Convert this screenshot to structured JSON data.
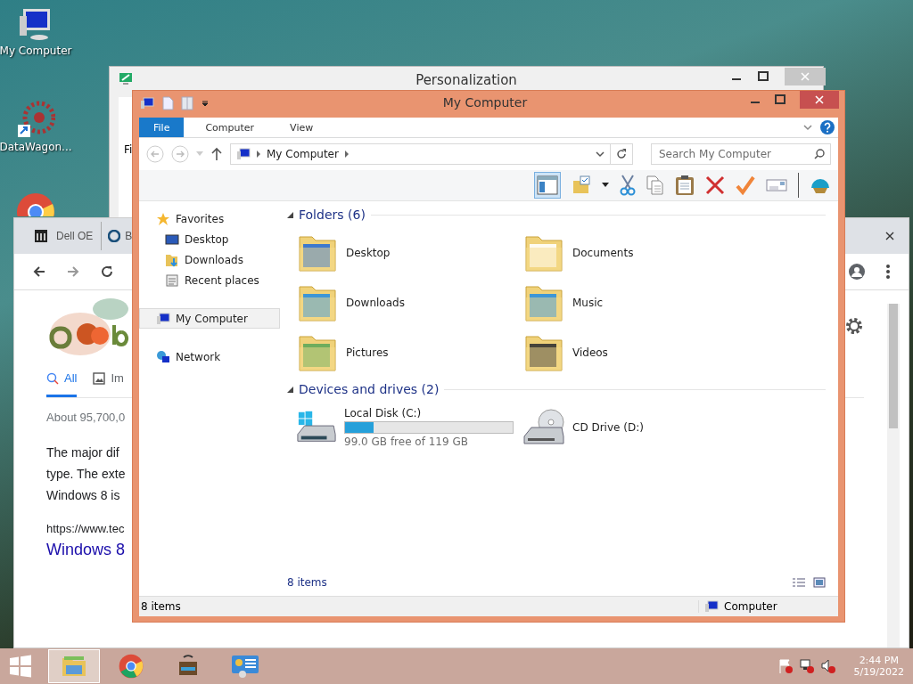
{
  "desktop_icons": [
    {
      "label": "My Computer",
      "kind": "computer"
    },
    {
      "label": "DataWagon...",
      "kind": "shortcut"
    },
    {
      "kind": "chrome"
    }
  ],
  "personalization_window": {
    "title": "Personalization",
    "menu_text": "Fi"
  },
  "browser_window": {
    "tabs": [
      "Dell OE",
      "B"
    ],
    "search_tabs": [
      {
        "label": "All",
        "selected": true,
        "kind": "search"
      },
      {
        "label": "Im",
        "selected": false,
        "kind": "image"
      }
    ],
    "result_count": "About 95,700,0",
    "snippet_lines": [
      "The major dif",
      "type. The exte",
      "Windows 8 is"
    ],
    "url": "https://www.tec",
    "result_title": "Windows 8"
  },
  "explorer": {
    "title": "My Computer",
    "ribbon_tabs": [
      {
        "label": "File",
        "selected": true
      },
      {
        "label": "Computer",
        "selected": false
      },
      {
        "label": "View",
        "selected": false
      }
    ],
    "address": "My Computer",
    "search_placeholder": "Search My Computer",
    "nav": [
      {
        "label": "Favorites",
        "kind": "star",
        "selected": false,
        "children": [
          {
            "label": "Desktop",
            "kind": "desktop",
            "selected": false
          },
          {
            "label": "Downloads",
            "kind": "downloads",
            "selected": false
          },
          {
            "label": "Recent places",
            "kind": "recent",
            "selected": false
          }
        ]
      },
      {
        "label": "My Computer",
        "kind": "computer",
        "selected": true
      },
      {
        "label": "Network",
        "kind": "network",
        "selected": false
      }
    ],
    "groups": [
      {
        "title": "Folders (6)",
        "items": [
          {
            "name": "Desktop",
            "kind": "desktop"
          },
          {
            "name": "Documents",
            "kind": "documents"
          },
          {
            "name": "Downloads",
            "kind": "downloads"
          },
          {
            "name": "Music",
            "kind": "music"
          },
          {
            "name": "Pictures",
            "kind": "pictures"
          },
          {
            "name": "Videos",
            "kind": "videos"
          }
        ]
      },
      {
        "title": "Devices and drives (2)",
        "items": [
          {
            "name": "Local Disk (C:)",
            "kind": "disk",
            "level": 0.17,
            "free": "99.0 GB free of 119 GB"
          },
          {
            "name": "CD Drive (D:)",
            "kind": "cd"
          }
        ]
      }
    ],
    "item_count": "8 items",
    "status_left": "8 items",
    "status_right": "Computer"
  },
  "taskbar": {
    "apps": [
      {
        "kind": "explorer",
        "selected": true
      },
      {
        "kind": "chrome",
        "selected": false
      },
      {
        "kind": "toolbox",
        "selected": false
      },
      {
        "kind": "control",
        "selected": false
      }
    ],
    "time": "2:44 PM",
    "date": "5/19/2022"
  }
}
